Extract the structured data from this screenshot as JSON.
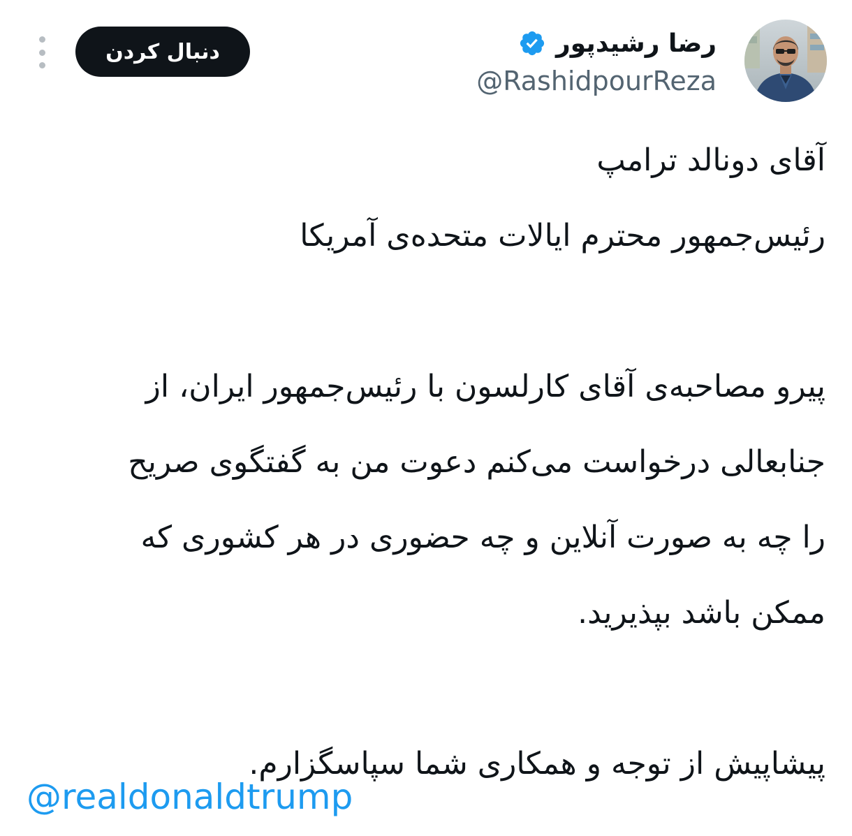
{
  "header": {
    "follow_label": "دنبال کردن",
    "more_icon": "more-vertical-icon",
    "avatar_icon": "profile-photo",
    "verified_icon": "verified-badge-icon",
    "verified_color": "#1d9bf0",
    "display_name": "رضا رشیدپور",
    "handle": "@RashidpourReza"
  },
  "tweet": {
    "lines": [
      "آقای دونالد ترامپ",
      "رئیس‌جمهور محترم ایالات متحده‌ی آمریکا",
      "",
      "پیرو مصاحبه‌ی آقای کارلسون با رئیس‌جمهور ایران، از",
      "جنابعالی درخواست می‌کنم دعوت من به گفتگوی صریح",
      "را چه به صورت آنلاین و چه حضوری در هر کشوری که",
      "ممکن باشد بپذیرید.",
      "",
      "پیشاپیش از توجه و همکاری شما سپاسگزارم."
    ],
    "mention": "@realdonaldtrump",
    "mention_color": "#1d9bf0"
  }
}
